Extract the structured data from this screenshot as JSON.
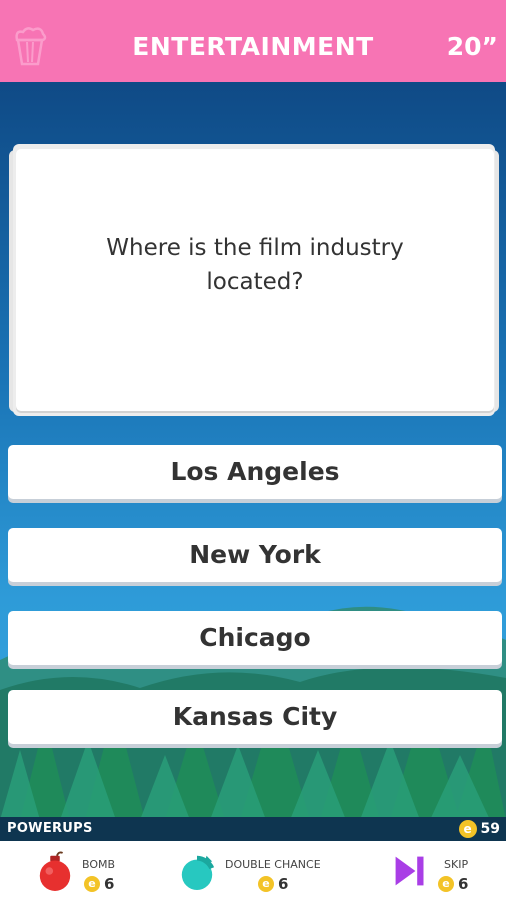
{
  "header": {
    "category": "ENTERTAINMENT",
    "timer": "20”",
    "icon": "popcorn-icon",
    "color": "#f774b4"
  },
  "question": {
    "text": "Where is the film industry located?"
  },
  "answers": [
    {
      "label": "Los Angeles"
    },
    {
      "label": "New York"
    },
    {
      "label": "Chicago"
    },
    {
      "label": "Kansas City"
    }
  ],
  "powerups_bar": {
    "label": "POWERUPS",
    "coin_icon": "coin-icon",
    "coins": "59"
  },
  "powerups": [
    {
      "name": "BOMB",
      "cost": "6",
      "icon": "bomb-icon",
      "color": "#e7302f"
    },
    {
      "name": "DOUBLE CHANCE",
      "cost": "6",
      "icon": "double-chance-icon",
      "color": "#27c8c0"
    },
    {
      "name": "SKIP",
      "cost": "6",
      "icon": "skip-icon",
      "color": "#a93ee6"
    }
  ]
}
